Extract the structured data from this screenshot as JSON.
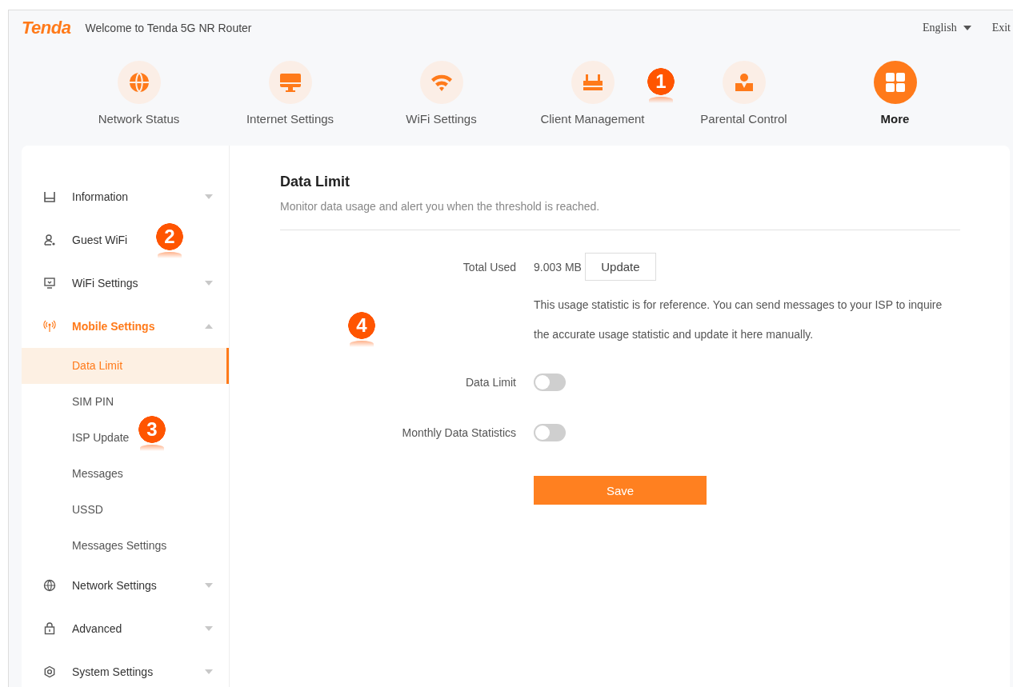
{
  "header": {
    "logo": "Tenda",
    "welcome": "Welcome to Tenda 5G NR Router",
    "language": "English",
    "exit": "Exit"
  },
  "nav": [
    {
      "label": "Network Status",
      "selected": false
    },
    {
      "label": "Internet Settings",
      "selected": false
    },
    {
      "label": "WiFi Settings",
      "selected": false
    },
    {
      "label": "Client Management",
      "selected": false
    },
    {
      "label": "Parental Control",
      "selected": false
    },
    {
      "label": "More",
      "selected": true
    }
  ],
  "sidebar": [
    {
      "label": "Information",
      "kind": "group",
      "expanded": false,
      "selected": false
    },
    {
      "label": "Guest WiFi",
      "kind": "link",
      "selected": false
    },
    {
      "label": "WiFi Settings",
      "kind": "group",
      "expanded": false,
      "selected": false
    },
    {
      "label": "Mobile Settings",
      "kind": "group",
      "expanded": true,
      "selected": true,
      "children": [
        {
          "label": "Data Limit",
          "selected": true
        },
        {
          "label": "SIM PIN",
          "selected": false
        },
        {
          "label": "ISP Update",
          "selected": false
        },
        {
          "label": "Messages",
          "selected": false
        },
        {
          "label": "USSD",
          "selected": false
        },
        {
          "label": "Messages Settings",
          "selected": false
        }
      ]
    },
    {
      "label": "Network Settings",
      "kind": "group",
      "expanded": false,
      "selected": false
    },
    {
      "label": "Advanced",
      "kind": "group",
      "expanded": false,
      "selected": false
    },
    {
      "label": "System Settings",
      "kind": "group",
      "expanded": false,
      "selected": false
    }
  ],
  "content": {
    "title": "Data Limit",
    "description": "Monitor data usage and alert you when the threshold is reached.",
    "total_used": {
      "label": "Total Used",
      "value": "9.003 MB",
      "button": "Update"
    },
    "note": "This usage statistic is for reference. You can send messages to your ISP to inquire the accurate usage statistic and update it here manually.",
    "toggles": [
      {
        "label": "Data Limit",
        "on": false
      },
      {
        "label": "Monthly Data Statistics",
        "on": false
      }
    ],
    "save": "Save"
  },
  "callouts": [
    {
      "number": "1"
    },
    {
      "number": "2"
    },
    {
      "number": "3"
    },
    {
      "number": "4"
    }
  ]
}
